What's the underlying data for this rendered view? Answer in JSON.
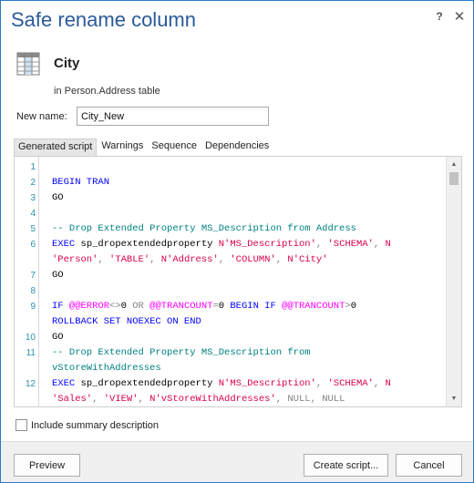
{
  "dialog": {
    "title": "Safe rename column",
    "help_glyph": "?",
    "close_glyph": "✕"
  },
  "object": {
    "name": "City",
    "subtitle": "in Person.Address table",
    "icon": "table-column-icon"
  },
  "new_name": {
    "label": "New name:",
    "value": "City_New"
  },
  "tabs": [
    {
      "label": "Generated script",
      "active": true
    },
    {
      "label": "Warnings",
      "active": false
    },
    {
      "label": "Sequence",
      "active": false
    },
    {
      "label": "Dependencies",
      "active": false
    }
  ],
  "script": {
    "line_numbers": [
      "1",
      "2",
      "3",
      "4",
      "5",
      "6",
      "",
      "7",
      "8",
      "9",
      "",
      "10",
      "11",
      "",
      "12",
      ""
    ],
    "lines": [
      [],
      [
        {
          "t": "BEGIN TRAN",
          "c": "kw"
        }
      ],
      [
        {
          "t": "GO",
          "c": "blk"
        }
      ],
      [],
      [
        {
          "t": "-- Drop Extended Property MS_Description from Address",
          "c": "cm"
        }
      ],
      [
        {
          "t": "EXEC ",
          "c": "kw"
        },
        {
          "t": "sp_dropextendedproperty ",
          "c": "blk"
        },
        {
          "t": "N'MS_Description'",
          "c": "str"
        },
        {
          "t": ", ",
          "c": "gray"
        },
        {
          "t": "'SCHEMA'",
          "c": "str"
        },
        {
          "t": ", ",
          "c": "gray"
        },
        {
          "t": "N",
          "c": "str"
        }
      ],
      [
        {
          "t": "'Person'",
          "c": "str"
        },
        {
          "t": ", ",
          "c": "gray"
        },
        {
          "t": "'TABLE'",
          "c": "str"
        },
        {
          "t": ", ",
          "c": "gray"
        },
        {
          "t": "N'Address'",
          "c": "str"
        },
        {
          "t": ", ",
          "c": "gray"
        },
        {
          "t": "'COLUMN'",
          "c": "str"
        },
        {
          "t": ", ",
          "c": "gray"
        },
        {
          "t": "N'City'",
          "c": "str"
        }
      ],
      [
        {
          "t": "GO",
          "c": "blk"
        }
      ],
      [],
      [
        {
          "t": "IF ",
          "c": "kw"
        },
        {
          "t": "@@ERROR",
          "c": "sys"
        },
        {
          "t": "<>",
          "c": "gray"
        },
        {
          "t": "0 ",
          "c": "blk"
        },
        {
          "t": "OR ",
          "c": "gray"
        },
        {
          "t": "@@TRANCOUNT",
          "c": "sys"
        },
        {
          "t": "=",
          "c": "gray"
        },
        {
          "t": "0 ",
          "c": "blk"
        },
        {
          "t": "BEGIN IF ",
          "c": "kw"
        },
        {
          "t": "@@TRANCOUNT",
          "c": "sys"
        },
        {
          "t": ">",
          "c": "gray"
        },
        {
          "t": "0",
          "c": "blk"
        }
      ],
      [
        {
          "t": "ROLLBACK SET NOEXEC ON END",
          "c": "kw"
        }
      ],
      [
        {
          "t": "GO",
          "c": "blk"
        }
      ],
      [
        {
          "t": "-- Drop Extended Property MS_Description from",
          "c": "cm"
        }
      ],
      [
        {
          "t": "vStoreWithAddresses",
          "c": "cm"
        }
      ],
      [
        {
          "t": "EXEC ",
          "c": "kw"
        },
        {
          "t": "sp_dropextendedproperty ",
          "c": "blk"
        },
        {
          "t": "N'MS_Description'",
          "c": "str"
        },
        {
          "t": ", ",
          "c": "gray"
        },
        {
          "t": "'SCHEMA'",
          "c": "str"
        },
        {
          "t": ", ",
          "c": "gray"
        },
        {
          "t": "N",
          "c": "str"
        }
      ],
      [
        {
          "t": "'Sales'",
          "c": "str"
        },
        {
          "t": ", ",
          "c": "gray"
        },
        {
          "t": "'VIEW'",
          "c": "str"
        },
        {
          "t": ", ",
          "c": "gray"
        },
        {
          "t": "N'vStoreWithAddresses'",
          "c": "str"
        },
        {
          "t": ", ",
          "c": "gray"
        },
        {
          "t": "NULL",
          "c": "gray"
        },
        {
          "t": ", ",
          "c": "gray"
        },
        {
          "t": "NULL",
          "c": "gray"
        }
      ]
    ]
  },
  "summary": {
    "label": "Include summary description",
    "checked": false
  },
  "buttons": {
    "preview": "Preview",
    "create_script": "Create script...",
    "cancel": "Cancel"
  },
  "colors": {
    "title": "#2a5a9a",
    "keyword": "#0000ff",
    "string": "#d9004c",
    "comment": "#008080",
    "system_var": "#ff00ff",
    "line_number": "#2b91af"
  }
}
